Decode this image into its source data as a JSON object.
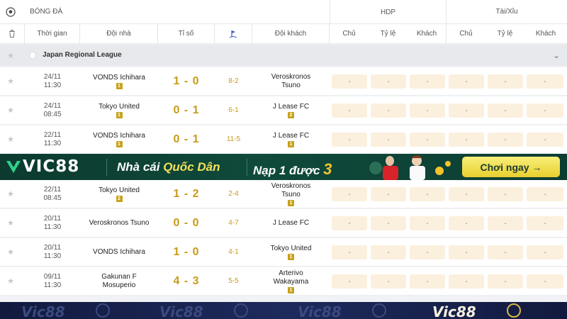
{
  "header": {
    "sport_label": "BÓNG ĐÁ",
    "hdp_label": "HDP",
    "tai_xiu_label": "Tài/Xỉu"
  },
  "columns": {
    "time": "Thời gian",
    "home": "Đội nhà",
    "score": "Tỉ số",
    "away": "Đội khách",
    "hdp_home": "Chủ",
    "hdp_ratio": "Tỷ lệ",
    "hdp_away": "Khách",
    "ou_home": "Chủ",
    "ou_ratio": "Tỷ lệ",
    "ou_away": "Khách"
  },
  "league": {
    "name": "Japan Regional League"
  },
  "matches": [
    {
      "date": "24/11",
      "time": "11:30",
      "home": "VONDS Ichihara",
      "home_badge": "1",
      "score": "1 - 0",
      "corners": "8-2",
      "away": "Veroskronos Tsuno",
      "away_badge": "",
      "odds": [
        "-",
        "-",
        "-",
        "-",
        "-",
        "-"
      ]
    },
    {
      "date": "24/11",
      "time": "08:45",
      "home": "Tokyo United",
      "home_badge": "1",
      "score": "0 - 1",
      "corners": "6-1",
      "away": "J Lease FC",
      "away_badge": "2",
      "odds": [
        "-",
        "-",
        "-",
        "-",
        "-",
        "-"
      ]
    },
    {
      "date": "22/11",
      "time": "11:30",
      "home": "VONDS Ichihara",
      "home_badge": "1",
      "score": "0 - 1",
      "corners": "11-5",
      "away": "J Lease FC",
      "away_badge": "1",
      "odds": [
        "-",
        "-",
        "-",
        "-",
        "-",
        "-"
      ]
    },
    {
      "date": "22/11",
      "time": "08:45",
      "home": "Tokyo United",
      "home_badge": "2",
      "score": "1 - 2",
      "corners": "2-4",
      "away": "Veroskronos Tsuno",
      "away_badge": "1",
      "odds": [
        "-",
        "-",
        "-",
        "-",
        "-",
        "-"
      ]
    },
    {
      "date": "20/11",
      "time": "11:30",
      "home": "Veroskronos Tsuno",
      "home_badge": "",
      "score": "0 - 0",
      "corners": "4-7",
      "away": "J Lease FC",
      "away_badge": "",
      "odds": [
        "-",
        "-",
        "-",
        "-",
        "-",
        "-"
      ]
    },
    {
      "date": "20/11",
      "time": "11:30",
      "home": "VONDS Ichihara",
      "home_badge": "",
      "score": "1 - 0",
      "corners": "4-1",
      "away": "Tokyo United",
      "away_badge": "1",
      "odds": [
        "-",
        "-",
        "-",
        "-",
        "-",
        "-"
      ]
    },
    {
      "date": "09/11",
      "time": "11:30",
      "home": "Gakunan F Mosuperio",
      "home_badge": "",
      "score": "4 - 3",
      "corners": "5-5",
      "away": "Arterivo Wakayama",
      "away_badge": "1",
      "odds": [
        "-",
        "-",
        "-",
        "-",
        "-",
        "-"
      ]
    }
  ],
  "banner": {
    "brand": "VIC88",
    "slogan_part1": "Nhà cái ",
    "slogan_part2": "Quốc Dân",
    "promo": "Nạp 1 được ",
    "promo_number": "3",
    "cta": "Chơi ngay →"
  },
  "banner2": {
    "brand": "Vic88"
  },
  "colors": {
    "score": "#c89b16",
    "odds_bg": "#fbf0dd",
    "banner_green": "#0f4a3b",
    "cta_yellow": "#f4e05a"
  }
}
